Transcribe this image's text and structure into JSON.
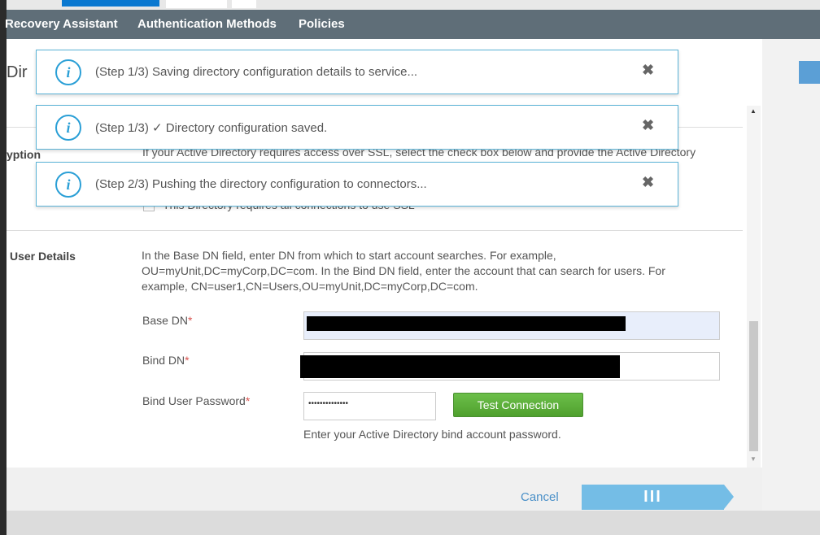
{
  "nav": {
    "items": [
      "Recovery Assistant",
      "Authentication Methods",
      "Policies"
    ]
  },
  "modal": {
    "title_partial": "Dir",
    "encryption": {
      "label": "yption",
      "description": "If your Active Directory requires access over SSL, select the check box below and provide the Active Directory",
      "checkbox_label": "This Directory requires all connections to use SSL"
    },
    "user_details": {
      "label": "User Details",
      "description_lines": [
        "In the Base DN field, enter DN from which to start account searches. For example,",
        "OU=myUnit,DC=myCorp,DC=com. In the Bind DN field, enter the account that can search for users. For",
        "example, CN=user1,CN=Users,OU=myUnit,DC=myCorp,DC=com."
      ],
      "base_dn_label": "Base DN",
      "bind_dn_label": "Bind DN",
      "password_label": "Bind User Password",
      "required_mark": "*",
      "password_value": "••••••••••••••",
      "test_connection": "Test Connection",
      "password_hint": "Enter your Active Directory bind account password."
    },
    "cancel": "Cancel",
    "next_progress": "III"
  },
  "toasts": [
    {
      "message": "(Step 1/3) Saving directory configuration details to service..."
    },
    {
      "message": "(Step 1/3) ✓ Directory configuration saved."
    },
    {
      "message": "(Step 2/3) Pushing the directory configuration to connectors..."
    }
  ],
  "colors": {
    "nav": "#5f6e78",
    "accent": "#2a9fd6",
    "green": "#5cb338"
  }
}
